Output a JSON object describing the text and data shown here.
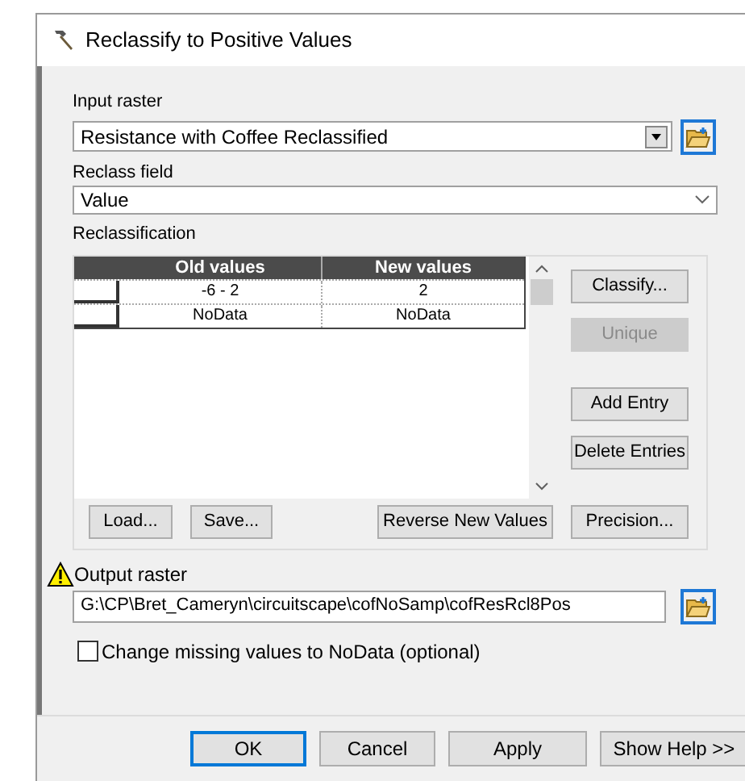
{
  "window": {
    "title": "Reclassify to Positive Values"
  },
  "input_raster": {
    "label": "Input raster",
    "value": "Resistance with Coffee Reclassified"
  },
  "reclass_field": {
    "label": "Reclass field",
    "value": "Value"
  },
  "reclassification": {
    "label": "Reclassification",
    "columns": [
      "Old values",
      "New values"
    ],
    "rows": [
      [
        "-6 - 2",
        "2"
      ],
      [
        "NoData",
        "NoData"
      ]
    ],
    "side_buttons": [
      {
        "label": "Classify...",
        "disabled": false
      },
      {
        "label": "Unique",
        "disabled": true
      },
      {
        "label": "Add Entry",
        "disabled": false
      },
      {
        "label": "Delete Entries",
        "disabled": false
      }
    ],
    "bottom_buttons": [
      "Load...",
      "Save...",
      "Reverse New Values",
      "Precision..."
    ]
  },
  "output_raster": {
    "label": "Output raster",
    "value": "G:\\CP\\Bret_Cameryn\\circuitscape\\cofNoSamp\\cofResRcl8Pos",
    "warning": true
  },
  "missing_to_nodata": {
    "label": "Change missing values to NoData (optional)",
    "checked": false
  },
  "buttons": [
    {
      "label": "OK",
      "default": true
    },
    {
      "label": "Cancel",
      "default": false
    },
    {
      "label": "Apply",
      "default": false
    },
    {
      "label": "Show Help >>",
      "default": false
    }
  ]
}
